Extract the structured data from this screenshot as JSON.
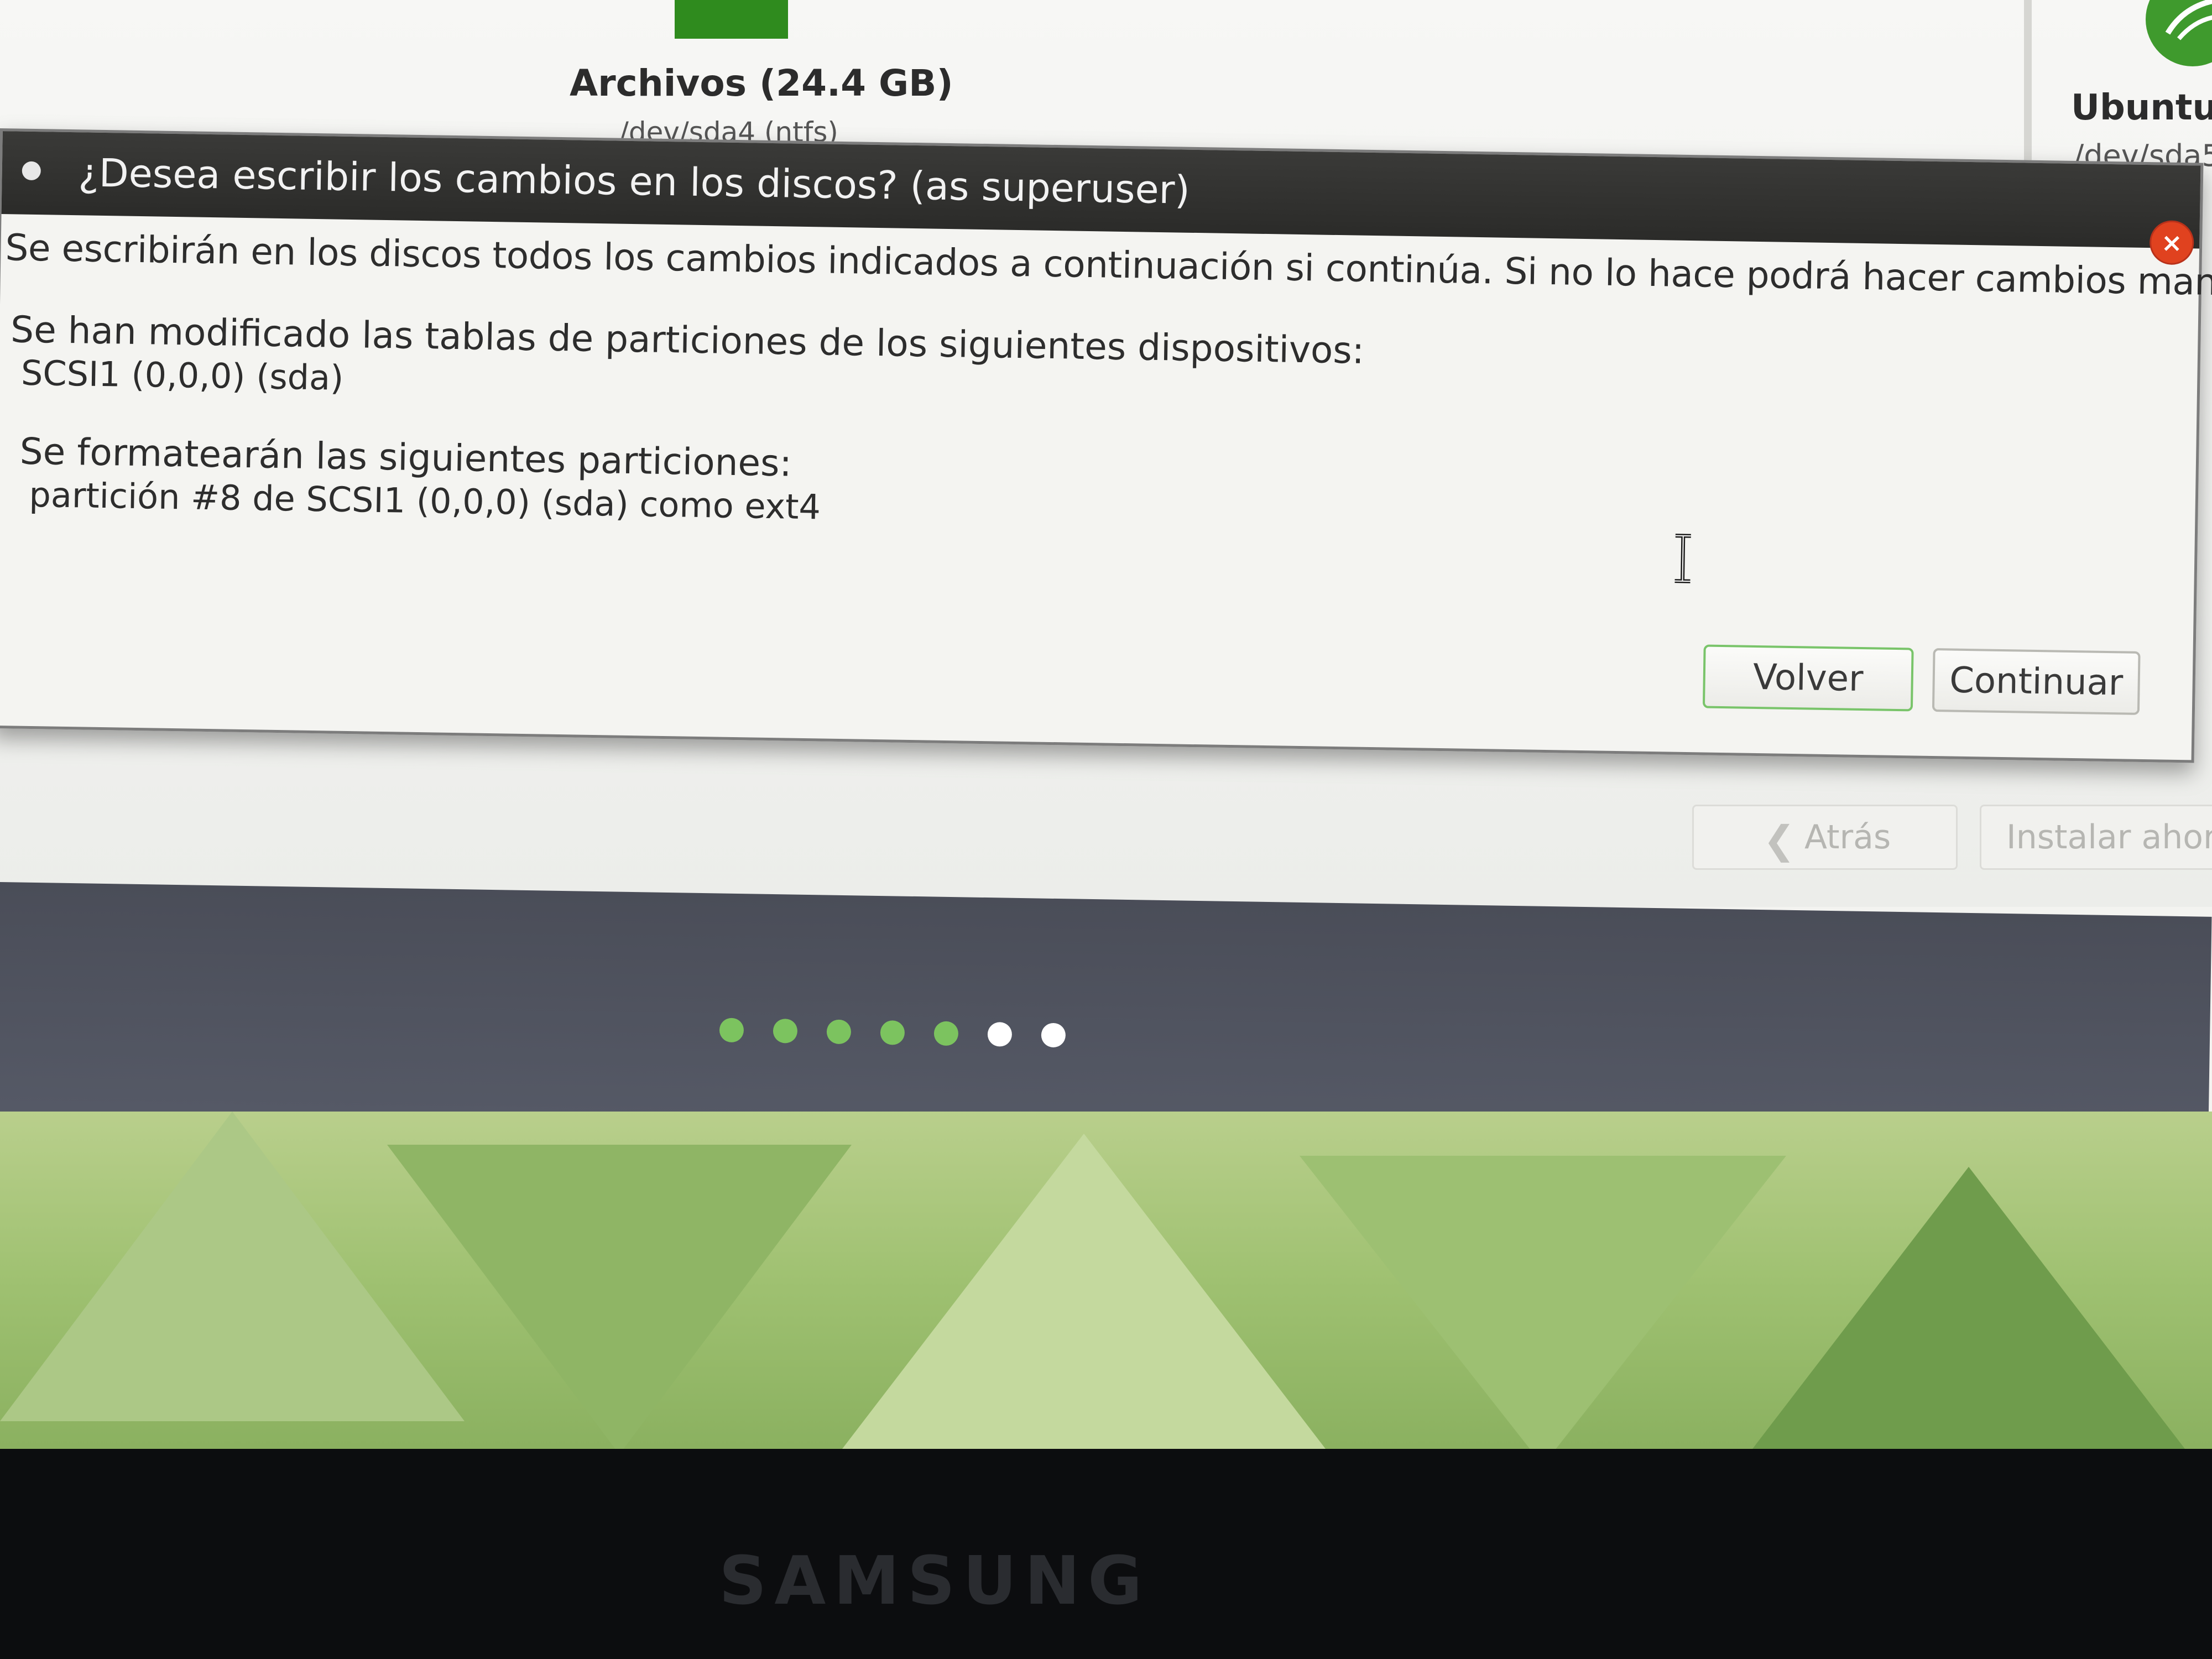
{
  "background_installer": {
    "partitions": [
      {
        "name": "Archivos (24.4 GB)",
        "device": "/dev/sda4 (ntfs)"
      },
      {
        "name": "Ubuntu",
        "device": "/dev/sda5"
      }
    ],
    "nav": {
      "back_label": "Atrás",
      "install_label": "Instalar ahora"
    },
    "progress": {
      "total_steps": 7,
      "completed_steps": 5
    }
  },
  "dialog": {
    "title": "¿Desea escribir los cambios en los discos? (as superuser)",
    "message": "Se escribirán en los discos todos los cambios indicados a continuación si continúa. Si no lo hace podrá hacer cambios manualmente.",
    "tables_heading": "Se han modificado las tablas de particiones de los siguientes dispositivos:",
    "device": "SCSI1 (0,0,0) (sda)",
    "format_heading": "Se formatearán las siguientes particiones:",
    "partition": "partición #8 de SCSI1 (0,0,0) (sda) como ext4",
    "buttons": {
      "back": "Volver",
      "continue": "Continuar"
    }
  },
  "monitor": {
    "brand": "SAMSUNG"
  },
  "colors": {
    "accent_green": "#2f8b1e",
    "dot_done": "#7cc35f",
    "dot_pending": "#ffffff",
    "close_red": "#e0421f"
  }
}
